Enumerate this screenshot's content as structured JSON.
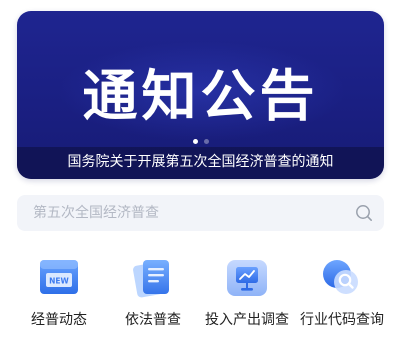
{
  "banner": {
    "title": "通知公告",
    "caption": "国务院关于开展第五次全国经济普查的通知",
    "slide_count": 2,
    "active_slide": 1
  },
  "search": {
    "placeholder": "第五次全国经济普查",
    "icon": "search-icon"
  },
  "quick_actions": [
    {
      "label": "经普动态",
      "icon": "news-icon"
    },
    {
      "label": "依法普查",
      "icon": "document-icon"
    },
    {
      "label": "投入产出调查",
      "icon": "chart-board-icon"
    },
    {
      "label": "行业代码查询",
      "icon": "code-search-icon"
    }
  ],
  "colors": {
    "banner_bg": "#1a1f82",
    "search_bg": "#f2f4f9",
    "icon_blue": "#3d7bf0",
    "text_dark": "#222222"
  }
}
